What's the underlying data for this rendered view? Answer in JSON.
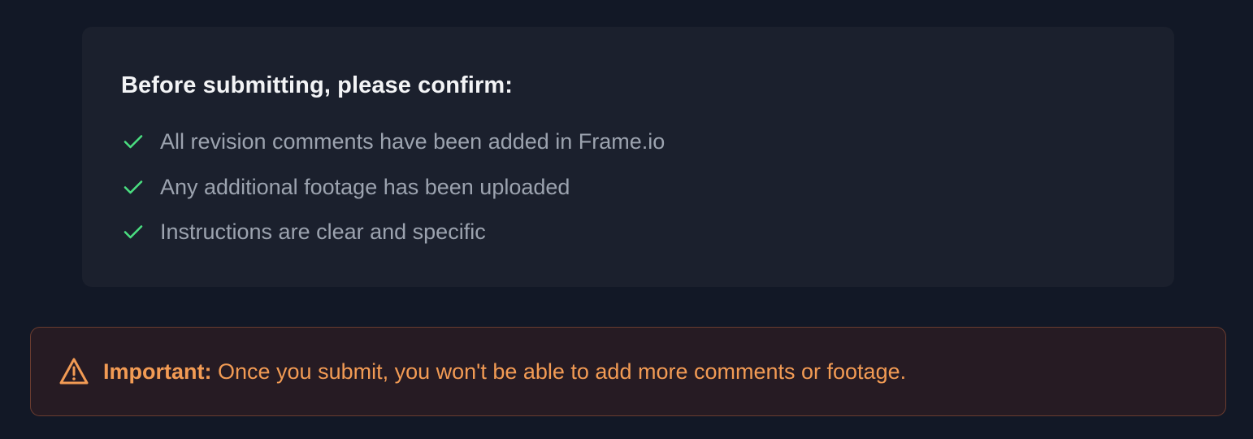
{
  "checklist": {
    "title": "Before submitting, please confirm:",
    "items": [
      {
        "label": "All revision comments have been added in Frame.io",
        "icon": "check-icon"
      },
      {
        "label": "Any additional footage has been uploaded",
        "icon": "check-icon"
      },
      {
        "label": "Instructions are clear and specific",
        "icon": "check-icon"
      }
    ]
  },
  "warning": {
    "icon": "alert-triangle-icon",
    "label": "Important:",
    "message": "Once you submit, you won't be able to add more comments or footage."
  },
  "colors": {
    "background": "#121826",
    "card": "#1b202d",
    "success": "#4ade80",
    "warning": "#f29b54"
  }
}
